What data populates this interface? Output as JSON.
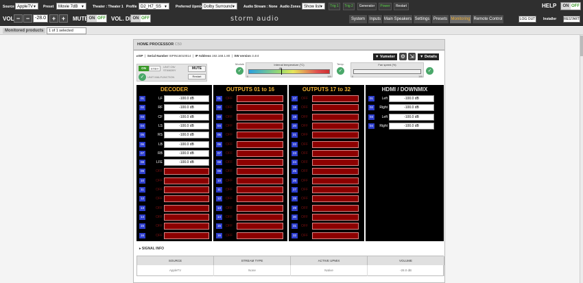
{
  "topbar": {
    "source_label": "Source",
    "source_value": "AppleTV",
    "preset_label": "Preset",
    "preset_value": "Movie 7dB",
    "theater_label": "Theater",
    "theater_value": "Theater 1",
    "profile_label": "Profile",
    "profile_value": "D2_H7_SS",
    "upmix_label": "Preferred Upmix",
    "upmix_value": "Dolby Surround",
    "audio_stream_label": "Audio Stream",
    "audio_stream_value": "None",
    "audio_zones_label": "Audio Zones",
    "audio_zones_value": "Show list",
    "trig1": "Trig 1",
    "trig2": "Trig 2",
    "generator": "Generator",
    "power": "Power",
    "restart": "Restart",
    "help": "HELP",
    "on": "ON",
    "off": "OFF",
    "vol_label": "VOL.",
    "vol_minus": "−",
    "vol_value": "-28.0",
    "vol_plus": "+",
    "mute_label": "MUTE",
    "voldim_label": "VOL. DIM",
    "logo": "storm audio",
    "nav": [
      "System",
      "Inputs",
      "Main Speakers",
      "Settings",
      "Presets",
      "Monitoring",
      "Remote Control"
    ],
    "active_nav": "Monitoring",
    "logout": "LOG OUT",
    "installer": "Installer",
    "restart_btn": "RESTART"
  },
  "monitored": {
    "title": "Monitored products",
    "selector": "1 of 1 selected"
  },
  "processor": {
    "title": "HOME PROCESSOR",
    "model": "C50",
    "id": "ISP",
    "serial_label": "Serial Number",
    "serial": "ISPIN16010014",
    "ip_label": "IP Address",
    "ip": "192.168.1.80",
    "sw_label": "SW version",
    "sw": "3.4r4",
    "vumeter": "Vumeter",
    "details": "Details",
    "on": "ON",
    "stby": "STBY",
    "unit_on": "UNIT ON/",
    "unit_standby": "STANDBY",
    "mute": "MUTE",
    "unit_malfunction": "UNIT MALFUNCTION",
    "restart": "Restart",
    "module_label": "Module",
    "temp_title": "Internal temperature (°C)",
    "temp_value": "40",
    "temp_min": "0",
    "temp_max": "100",
    "temp_label": "Temp.",
    "fan_title": "Fan speed (%)",
    "fan_min": "0",
    "fan_max": "100"
  },
  "decoder": {
    "header": "DECODER",
    "channels": [
      {
        "n": "01",
        "name": "LF",
        "val": "-100.0 dB"
      },
      {
        "n": "02",
        "name": "RF",
        "val": "-100.0 dB"
      },
      {
        "n": "03",
        "name": "CF",
        "val": "-100.0 dB"
      },
      {
        "n": "04",
        "name": "LS",
        "val": "-100.0 dB"
      },
      {
        "n": "05",
        "name": "RS",
        "val": "-100.0 dB"
      },
      {
        "n": "06",
        "name": "LB",
        "val": "-100.0 dB"
      },
      {
        "n": "07",
        "name": "RB",
        "val": "-100.0 dB"
      },
      {
        "n": "08",
        "name": "LFE",
        "val": "-100.0 dB"
      },
      {
        "n": "09",
        "name": "OFF",
        "val": ""
      },
      {
        "n": "10",
        "name": "OFF",
        "val": ""
      },
      {
        "n": "11",
        "name": "OFF",
        "val": ""
      },
      {
        "n": "12",
        "name": "OFF",
        "val": ""
      },
      {
        "n": "13",
        "name": "OFF",
        "val": ""
      },
      {
        "n": "14",
        "name": "OFF",
        "val": ""
      },
      {
        "n": "15",
        "name": "OFF",
        "val": ""
      },
      {
        "n": "16",
        "name": "OFF",
        "val": ""
      }
    ]
  },
  "outputs1": {
    "header": "OUTPUTS 01 to 16",
    "channels": [
      {
        "n": "01",
        "name": "OFF"
      },
      {
        "n": "02",
        "name": "OFF"
      },
      {
        "n": "03",
        "name": "OFF"
      },
      {
        "n": "04",
        "name": "OFF"
      },
      {
        "n": "05",
        "name": "OFF"
      },
      {
        "n": "06",
        "name": "OFF"
      },
      {
        "n": "07",
        "name": "OFF"
      },
      {
        "n": "08",
        "name": "OFF"
      },
      {
        "n": "09",
        "name": "OFF"
      },
      {
        "n": "10",
        "name": "OFF"
      },
      {
        "n": "11",
        "name": "OFF"
      },
      {
        "n": "12",
        "name": "OFF"
      },
      {
        "n": "13",
        "name": "OFF"
      },
      {
        "n": "14",
        "name": "OFF"
      },
      {
        "n": "15",
        "name": "OFF"
      },
      {
        "n": "16",
        "name": "OFF"
      }
    ]
  },
  "outputs2": {
    "header": "OUTPUTS 17 to 32",
    "channels": [
      {
        "n": "17",
        "name": "OFF"
      },
      {
        "n": "18",
        "name": "OFF"
      },
      {
        "n": "19",
        "name": "OFF"
      },
      {
        "n": "20",
        "name": "OFF"
      },
      {
        "n": "21",
        "name": "OFF"
      },
      {
        "n": "22",
        "name": "OFF"
      },
      {
        "n": "23",
        "name": "OFF"
      },
      {
        "n": "24",
        "name": "OFF"
      },
      {
        "n": "25",
        "name": "OFF"
      },
      {
        "n": "26",
        "name": "OFF"
      },
      {
        "n": "27",
        "name": "OFF"
      },
      {
        "n": "28",
        "name": "OFF"
      },
      {
        "n": "29",
        "name": "OFF"
      },
      {
        "n": "30",
        "name": "OFF"
      },
      {
        "n": "31",
        "name": "OFF"
      },
      {
        "n": "32",
        "name": "OFF"
      }
    ]
  },
  "hdmi": {
    "header": "HDMI / DOWNMIX",
    "channels": [
      {
        "n": "01",
        "name": "Left",
        "val": "-100.0 dB"
      },
      {
        "n": "02",
        "name": "Right",
        "val": "-100.0 dB"
      },
      {
        "n": "03",
        "name": "Left",
        "val": "-100.0 dB"
      },
      {
        "n": "04",
        "name": "Right",
        "val": "-100.0 dB"
      }
    ]
  },
  "signal": {
    "title": "SIGNAL INFO",
    "headers": [
      "SOURCE",
      "STREAM TYPE",
      "ACTIVE UPMIX",
      "VOLUME"
    ],
    "values": [
      "AppleTV",
      "None",
      "Native",
      "-28.0 dB"
    ]
  },
  "colors": {
    "accent": "#f2b134",
    "channel_num_bg": "#2e3fcf",
    "off_level": "#8c0000",
    "status_ok": "#4aa86a"
  },
  "fan_level": 0,
  "temp_level": 0.4
}
